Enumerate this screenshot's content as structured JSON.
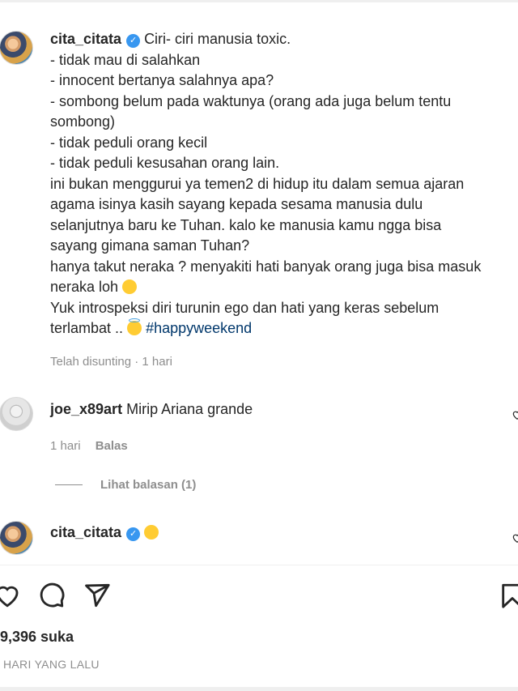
{
  "post": {
    "username": "cita_citata",
    "caption_first": "Ciri- ciri manusia toxic.",
    "caption_lines": [
      "- tidak mau di salahkan",
      "- innocent bertanya salahnya apa?",
      "- sombong belum pada waktunya (orang ada juga belum tentu",
      "sombong)",
      "- tidak peduli orang kecil",
      "- tidak peduli kesusahan orang lain.",
      "ini bukan menggurui ya temen2 di hidup itu dalam semua ajaran",
      "agama isinya kasih sayang kepada sesama manusia dulu",
      "selanjutnya baru ke Tuhan. kalo ke manusia kamu ngga bisa",
      "sayang gimana saman Tuhan?",
      "hanya takut neraka ? menyakiti hati banyak orang juga bisa masuk",
      "neraka loh",
      "Yuk introspeksi diri turunin ego dan hati yang keras sebelum"
    ],
    "caption_last": "terlambat .. ",
    "hashtag": "#happyweekend",
    "edited_time": "Telah disunting · 1 hari"
  },
  "comments": [
    {
      "username": "joe_x89art",
      "text": "Mirip Ariana grande",
      "time": "1 hari",
      "reply_label": "Balas",
      "view_replies": "Lihat balasan (1)"
    },
    {
      "username": "cita_citata",
      "text": ""
    }
  ],
  "actions": {
    "icons": [
      "heart-icon",
      "comment-icon",
      "share-icon",
      "bookmark-icon"
    ]
  },
  "likes": "9,396 suka",
  "time_ago": "HARI YANG LALU"
}
